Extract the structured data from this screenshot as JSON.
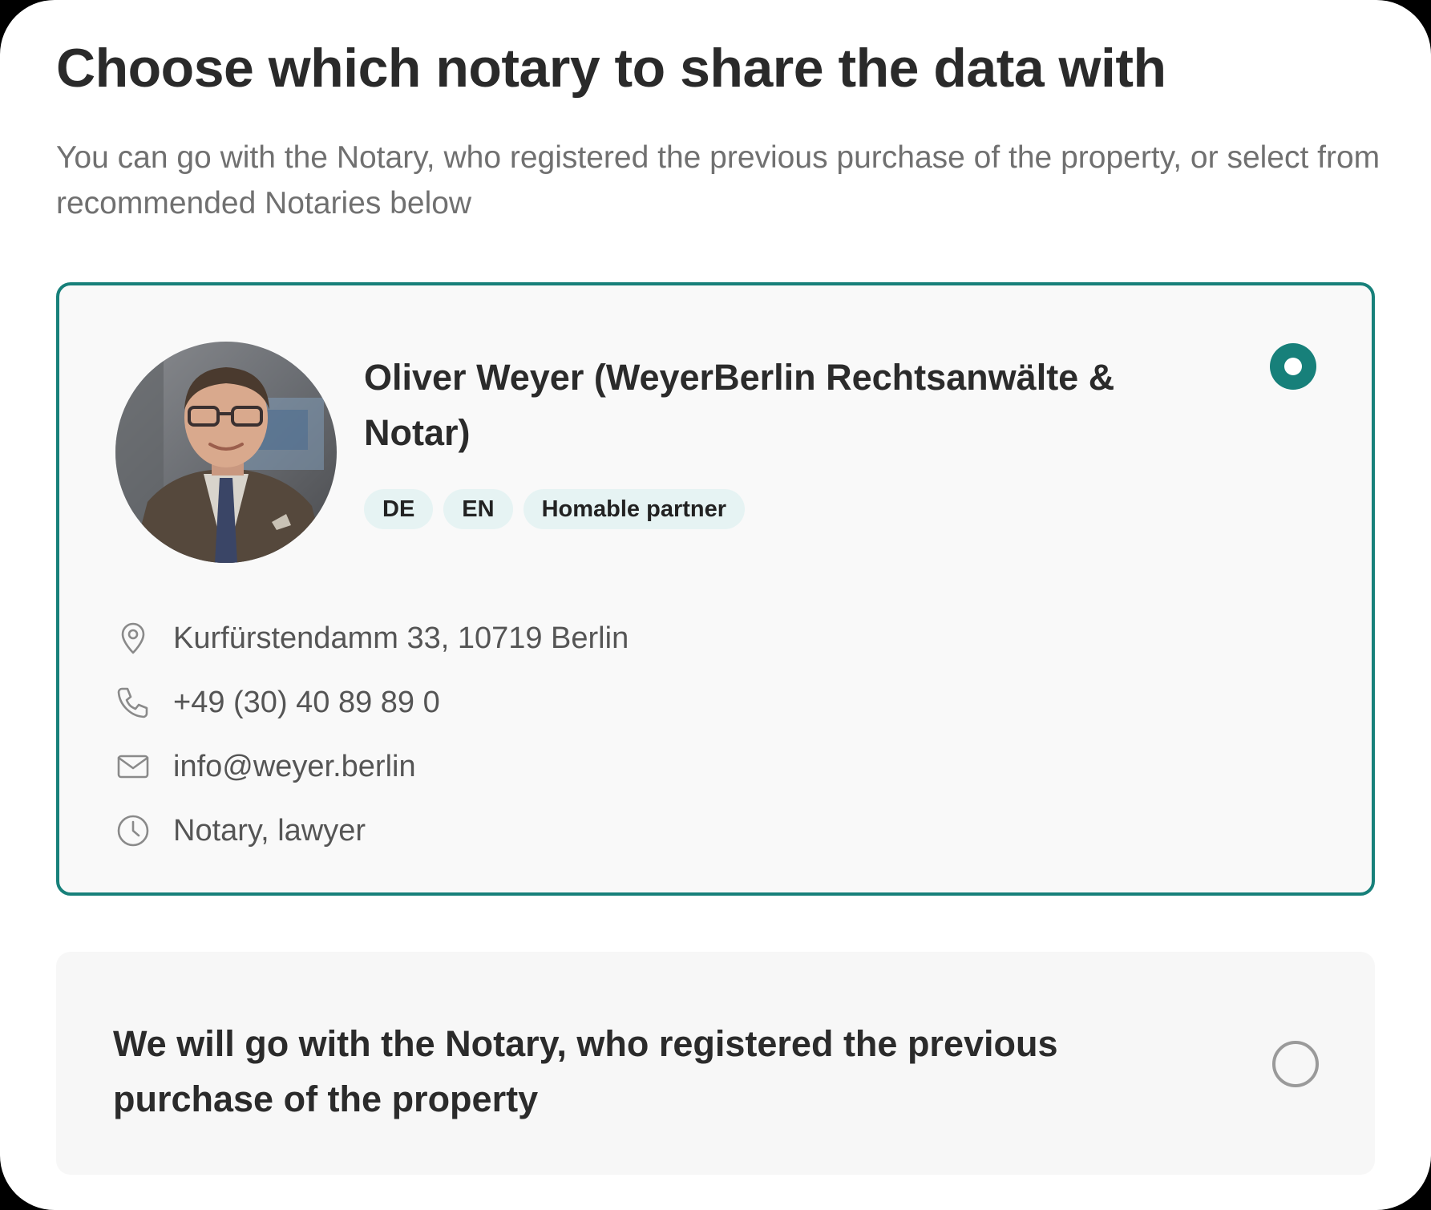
{
  "heading": "Choose which notary to share the data with",
  "subheading": "You can go with the Notary, who registered the previous purchase of the property, or select from recommended Notaries below",
  "selected_notary": {
    "name": "Oliver Weyer (WeyerBerlin Rechtsanwälte & Notar)",
    "badges": [
      "DE",
      "EN",
      "Homable partner"
    ],
    "address": "Kurfürstendamm 33, 10719 Berlin",
    "phone": "+49 (30) 40 89 89 0",
    "email": "info@weyer.berlin",
    "profession": "Notary, lawyer",
    "selected": true
  },
  "alternative_option": {
    "label": "We will go with the Notary, who registered the previous purchase of the property",
    "selected": false
  },
  "colors": {
    "accent": "#17807a",
    "badge_bg": "#e6f3f3",
    "card_bg": "#f9f9f9"
  },
  "icons": [
    "location-pin-icon",
    "phone-icon",
    "mail-icon",
    "clock-icon"
  ]
}
